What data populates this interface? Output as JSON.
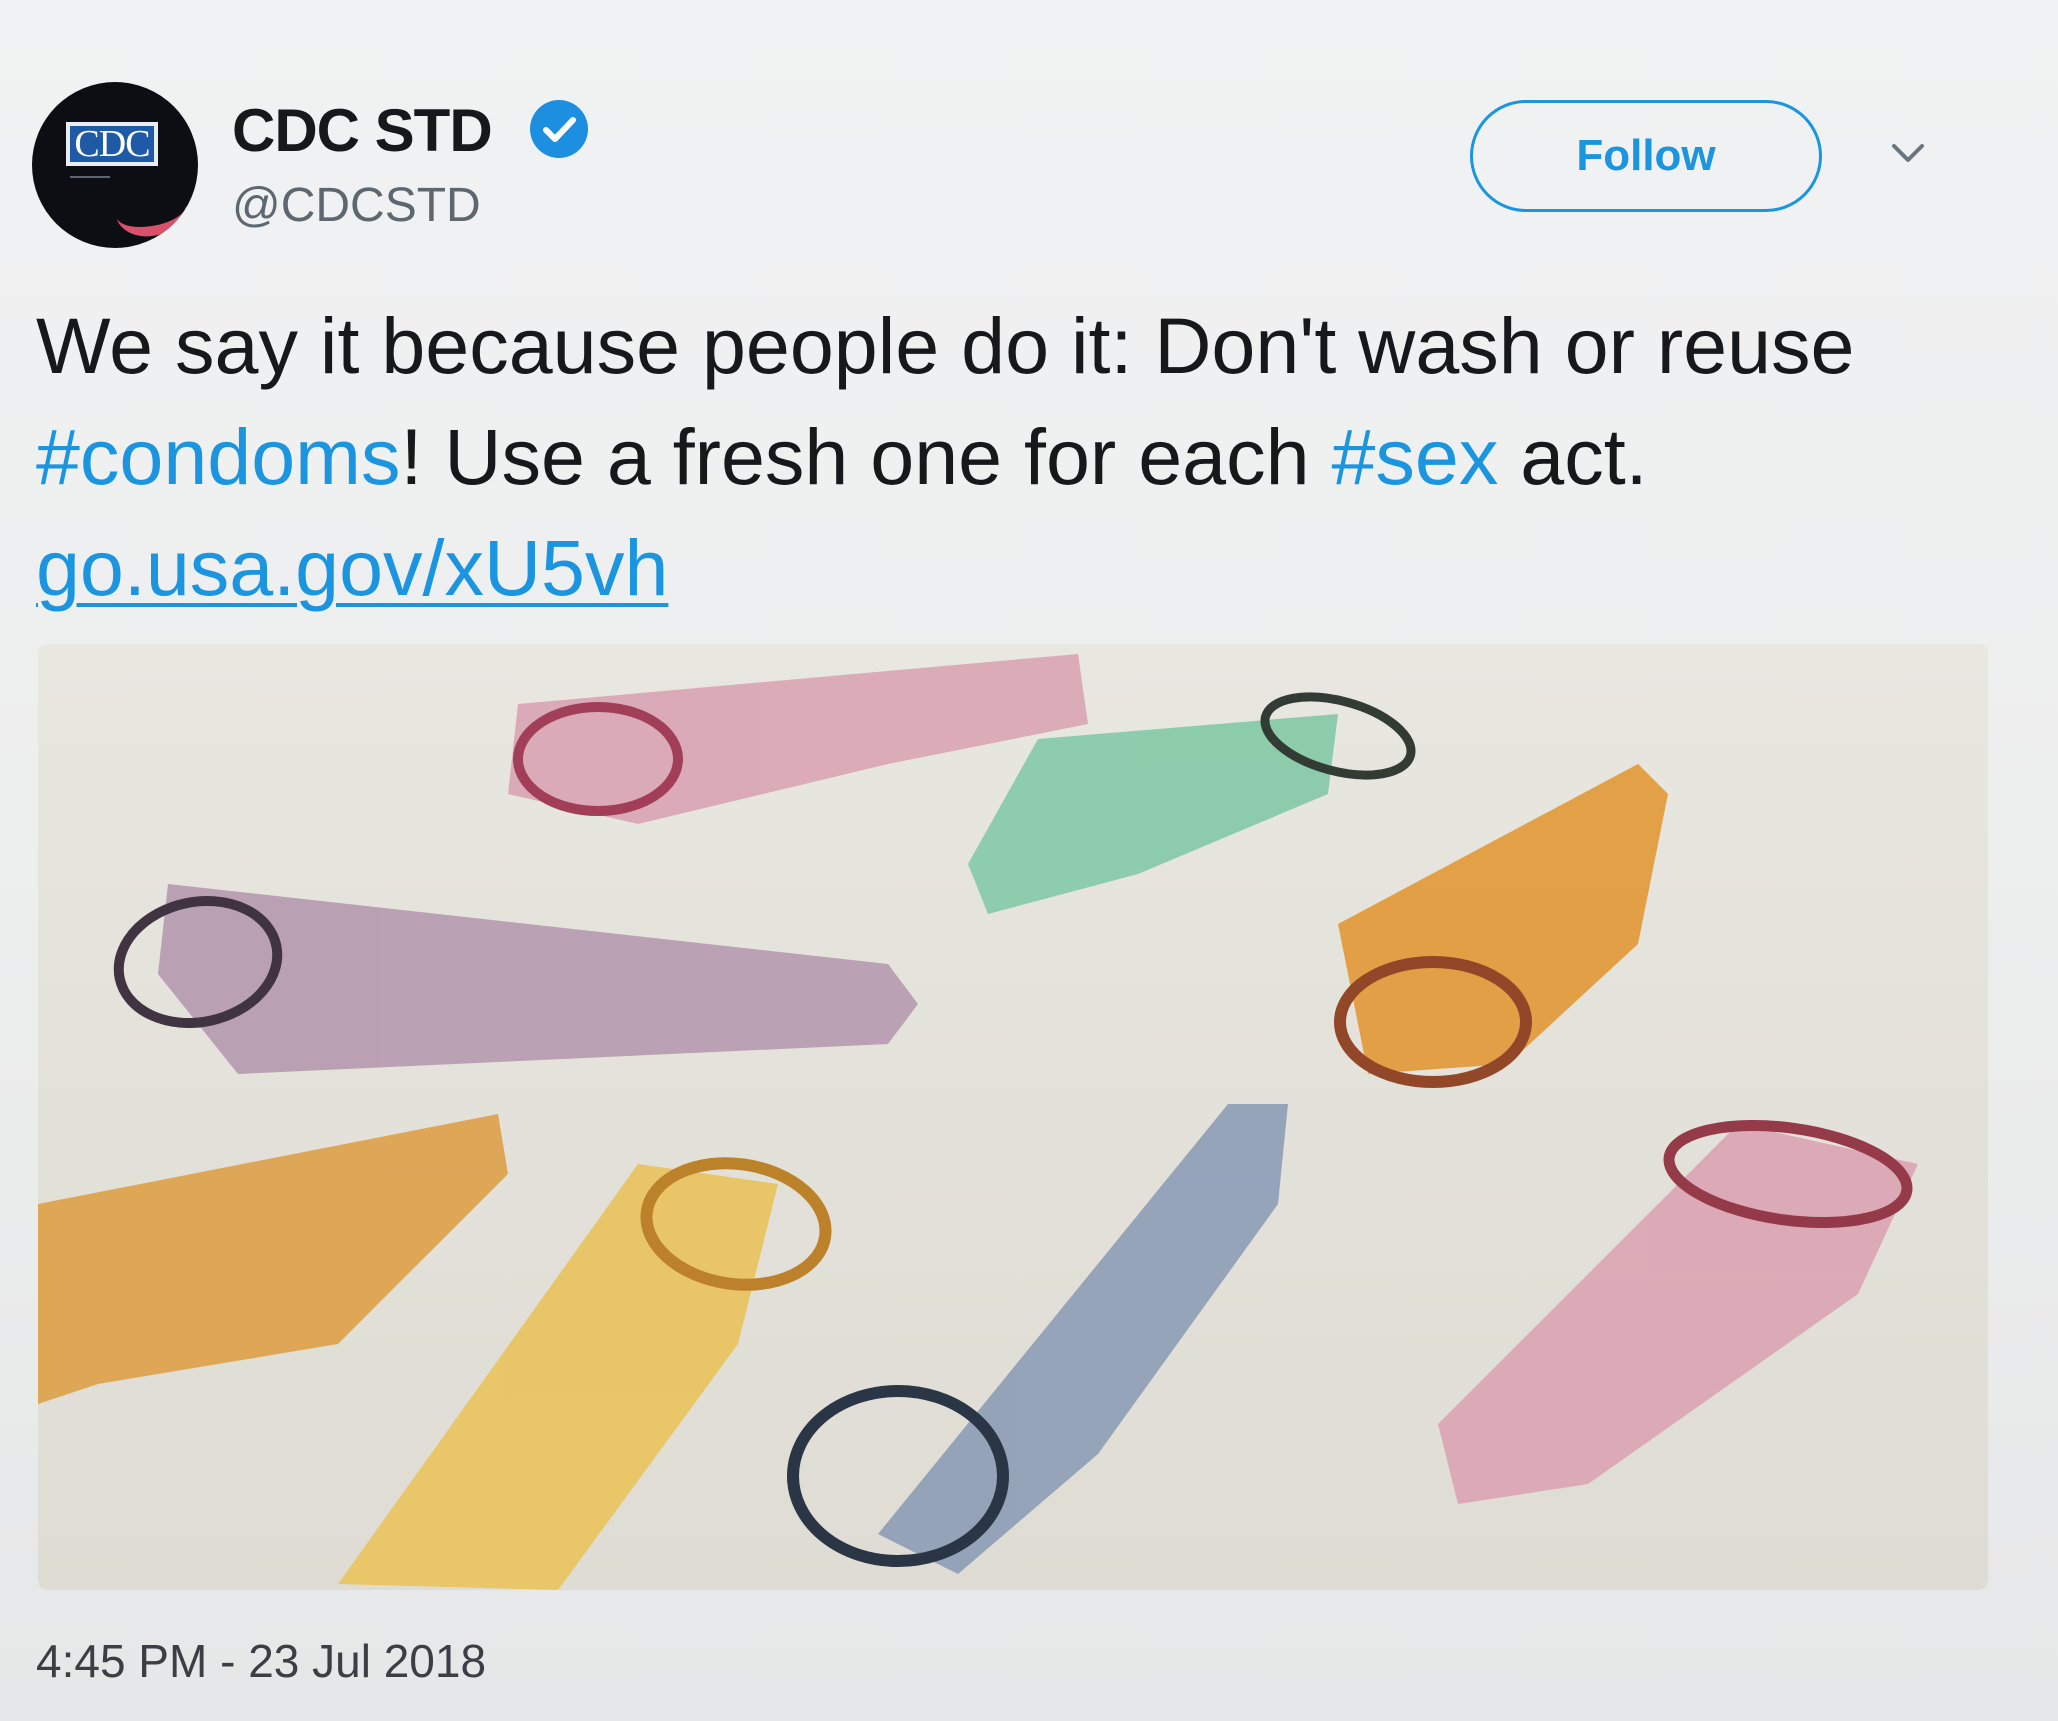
{
  "account": {
    "display_name": "CDC STD",
    "handle": "@CDCSTD",
    "avatar_text": "CDC",
    "verified": true
  },
  "actions": {
    "follow_label": "Follow"
  },
  "tweet": {
    "part1": "We say it because people do it: Don't wash or reuse ",
    "hashtag1": "#condoms",
    "part2": "! Use a fresh one for each ",
    "hashtag2": "#sex",
    "part3": " act. ",
    "link": "go.usa.gov/xU5vh"
  },
  "timestamp": "4:45 PM - 23 Jul 2018",
  "colors": {
    "accent": "#1b95e0",
    "verified": "#1d8fe0",
    "text": "#16181b",
    "muted": "#5e6770"
  }
}
